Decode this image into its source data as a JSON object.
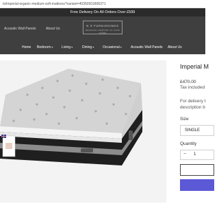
{
  "browser": {
    "url": "ts/imperial-organic-medium-soft-mattress?variant=40350501806371"
  },
  "announcement": {
    "text": "Free Delivery On All Orders Over £599"
  },
  "header": {
    "left_links": [
      "Acoustic Wall Panels",
      "About Us"
    ],
    "logo_name": "N S FURNISHINGS",
    "logo_tagline": "BRINGING COMFORT TO YOUR HOME",
    "nav": [
      {
        "label": "Home",
        "dropdown": false
      },
      {
        "label": "Bedroom",
        "dropdown": true
      },
      {
        "label": "Living",
        "dropdown": true
      },
      {
        "label": "Dining",
        "dropdown": true
      },
      {
        "label": "Occasional",
        "dropdown": true
      },
      {
        "label": "Acoustic Wall Panels",
        "dropdown": false
      },
      {
        "label": "About Us",
        "dropdown": false
      }
    ]
  },
  "product": {
    "title": "Imperial M",
    "price": "£470.00",
    "tax_note": "Tax included",
    "delivery_line1": "For delivery t",
    "delivery_line2": "description b",
    "size_label": "Size",
    "size_value": "SINGLE",
    "quantity_label": "Quantity",
    "quantity_minus": "−",
    "quantity_value": "1"
  },
  "colors": {
    "announce_bg": "#2b2b2b",
    "header_bg": "#3f3f3f",
    "buy_button": "#5b59d6"
  }
}
